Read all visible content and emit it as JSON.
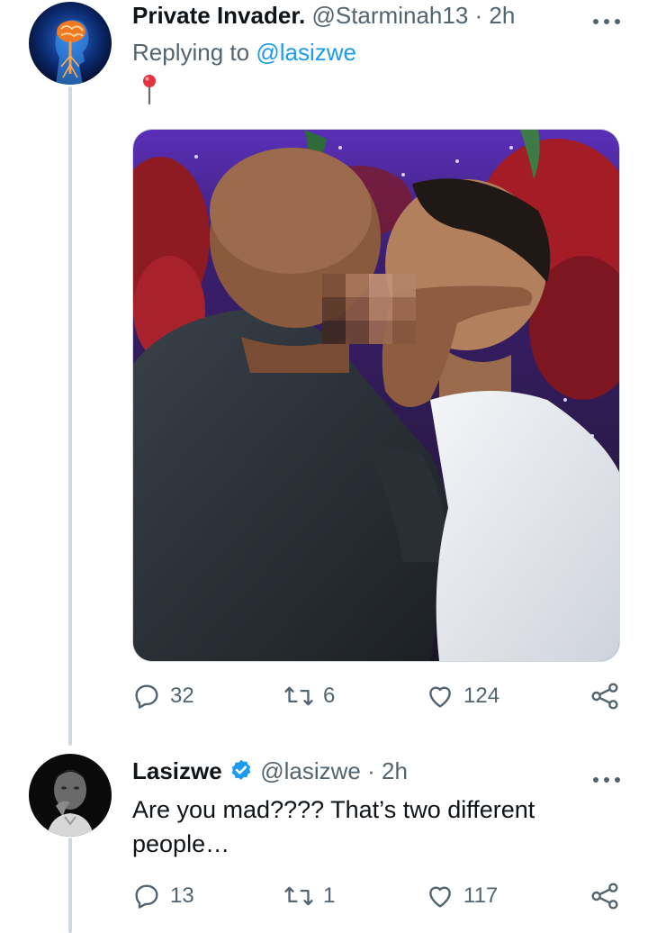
{
  "tweets": [
    {
      "display_name": "Private Invader.",
      "handle": "@Starminah13",
      "separator": "·",
      "time": "2h",
      "reply_label": "Replying to",
      "reply_handle": "@lasizwe",
      "text": "",
      "pin_icon": "round-pushpin-emoji",
      "stats": {
        "replies": "32",
        "retweets": "6",
        "likes": "124"
      }
    },
    {
      "display_name": "Lasizwe",
      "verified": true,
      "handle": "@lasizwe",
      "separator": "·",
      "time": "2h",
      "text": "Are you mad????  That’s two different people…",
      "stats": {
        "replies": "13",
        "retweets": "1",
        "likes": "117"
      }
    }
  ],
  "icons": [
    "more-icon",
    "reply-icon",
    "retweet-icon",
    "like-icon",
    "share-icon",
    "verified-badge-icon"
  ],
  "colors": {
    "accent": "#1d9bf0",
    "secondary_text": "#536471",
    "thread_line": "#cfd9de"
  }
}
